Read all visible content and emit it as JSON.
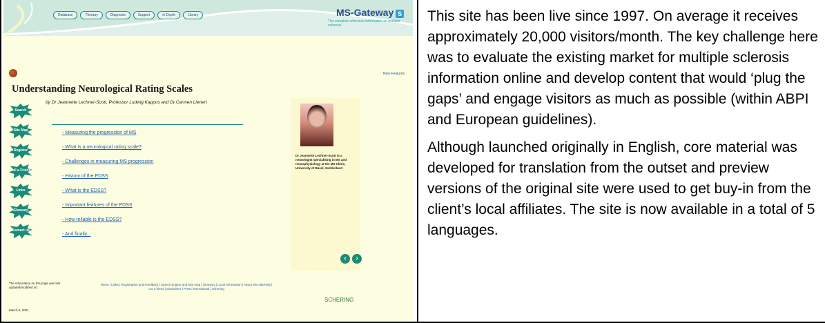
{
  "screenshot": {
    "nav_tabs": [
      "Database",
      "Therapy",
      "Diagnosis",
      "Support",
      "In Depth",
      "Library"
    ],
    "brand": "MS-Gateway",
    "brand_mark": "S",
    "brand_tagline": "The complete reference information on multiple sclerosis",
    "new_link": "New Features",
    "page_title": "Understanding Neurological Rating Scales",
    "authors": "by Dr Jeannette Lechner-Scott, Professor Ludwig Kappos and Dr Carmen Lienert",
    "sidebar": [
      "Search",
      "Site Map",
      "Register",
      "Tell a Friend",
      "Links",
      "Glossary",
      "Contact us"
    ],
    "menu": [
      "Measuring the progression of MS",
      "What is a neurological rating scale?",
      "Challenges in measuring MS progression",
      "History of the EDSS",
      "What is the EDSS?",
      "Important features of the EDSS",
      "How reliable is the EDSS?",
      "And finally..."
    ],
    "photo_caption": "Dr Jeannette Lechner-Scott is a neurologist specialising in MS and neurophysiology at the MS Clinic, University of Basel, Switzerland",
    "footer_note": "The information on this page was last updated/modified on:",
    "footer_date": "March 6, 2001",
    "footer_links": "Home | Links | Registration and Feedback | Search Engine and Site map | Glossary | Local Information | About this site/Help | Let a friend | Disclaimer | Press international | Schering",
    "sponsor": "SCHERING"
  },
  "description": {
    "paragraphs": [
      "This site has been live since 1997. On average it receives approximately 20,000 visitors/month. The key challenge here was to evaluate the existing market for multiple sclerosis information online and develop content that would ‘plug the gaps’ and engage visitors as much as possible (within ABPI and European guidelines).",
      "Although launched originally in English, core material was developed for translation from the outset and preview versions of the original site were used to get buy-in from the client’s local affiliates. The site is now available in a total of 5 languages."
    ]
  },
  "colors": {
    "accent_teal": "#1b8a76",
    "link_blue": "#1e5fa9",
    "brand_blue": "#2a4f93",
    "panel_cream": "#fdfde2"
  }
}
